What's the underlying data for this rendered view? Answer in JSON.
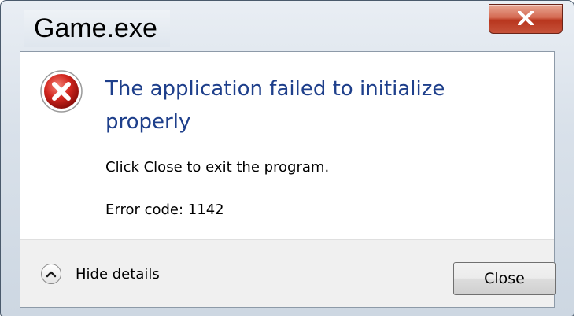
{
  "window": {
    "title": "Game.exe",
    "close_glyph": "X"
  },
  "message": {
    "icon": "error-icon",
    "headline": "The application failed to initialize properly",
    "instruction": "Click Close to exit the program.",
    "error_code": "Error code: 1142"
  },
  "footer": {
    "details_toggle_label": "Hide details",
    "details_icon": "chevron-up-icon",
    "close_button_label": "Close"
  },
  "colors": {
    "headline": "#1e3f8b",
    "error_red": "#c8201c",
    "close_x_red": "#c6523a"
  }
}
